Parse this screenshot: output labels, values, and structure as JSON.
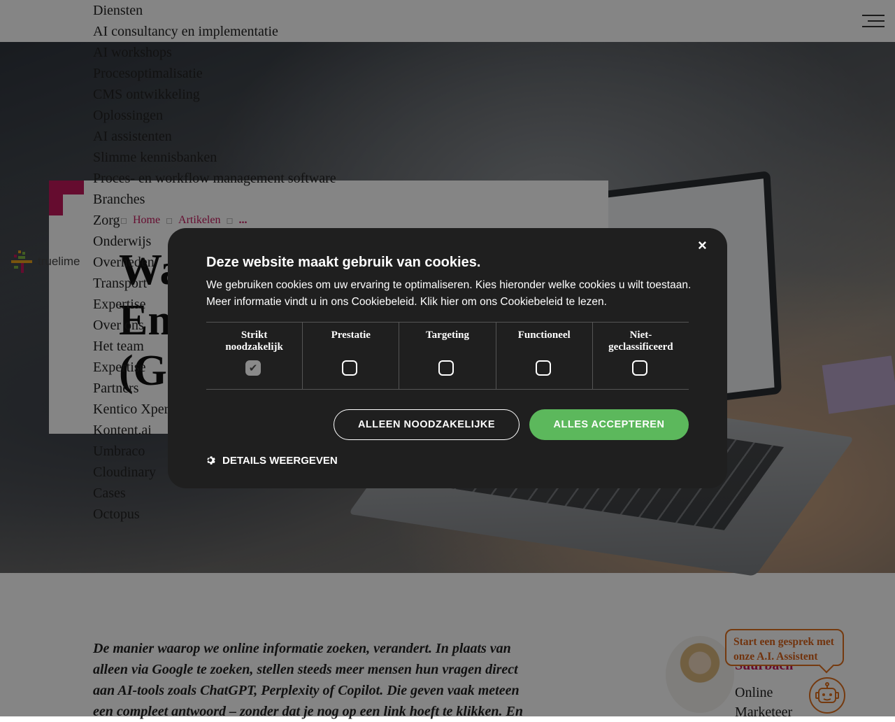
{
  "nav": {
    "menu_items": [
      "Diensten",
      "AI consultancy en implementatie",
      "AI workshops",
      "Procesoptimalisatie",
      "CMS ontwikkeling",
      "Oplossingen",
      "AI assistenten",
      "Slimme kennisbanken",
      "Proces- en workflow management software",
      "Branches",
      "Zorg",
      "Onderwijs",
      "Overheden",
      "Transport",
      "Expertise",
      "Over ons",
      "Het team",
      "Expertise",
      "Partners",
      "Kentico Xperience",
      "Kontent.ai",
      "Umbraco",
      "Cloudinary",
      "Cases",
      "Octopus"
    ]
  },
  "logo": {
    "text": "truelime"
  },
  "breadcrumb": {
    "home": "Home",
    "articles": "Artikelen",
    "current": "..."
  },
  "article": {
    "title_lines": [
      "Wa",
      "En",
      "(G"
    ],
    "intro": "De manier waarop we online informatie zoeken, verandert. In plaats van alleen via Google te zoeken, stellen steeds meer mensen hun vragen direct aan AI-tools zoals ChatGPT, Perplexity of Copilot. Die geven vaak meteen een compleet antwoord – zonder dat je nog op een link hoeft te klikken. En"
  },
  "author": {
    "name": "Suurbach",
    "role": "Online Marketeer"
  },
  "chat": {
    "bubble": "Start een gesprek met onze A.I. Assistent"
  },
  "cookie": {
    "title": "Deze website maakt gebruik van cookies.",
    "description": "We gebruiken cookies om uw ervaring te optimaliseren. Kies hieronder welke cookies u wilt toestaan. Meer informatie vindt u in ons Cookiebeleid. Klik hier om ons Cookiebeleid te lezen.",
    "categories": [
      {
        "label": "Strikt noodzakelijk",
        "checked": true
      },
      {
        "label": "Prestatie",
        "checked": false
      },
      {
        "label": "Targeting",
        "checked": false
      },
      {
        "label": "Functioneel",
        "checked": false
      },
      {
        "label": "Niet-geclassificeerd",
        "checked": false
      }
    ],
    "btn_necessary": "ALLEEN NOODZAKELIJKE",
    "btn_accept": "ALLES ACCEPTEREN",
    "details": "DETAILS WEERGEVEN",
    "close": "×"
  },
  "colors": {
    "accent": "#c2185b",
    "accept": "#5cb85c",
    "chat": "#e0701e",
    "modal": "#1f1f1f"
  }
}
